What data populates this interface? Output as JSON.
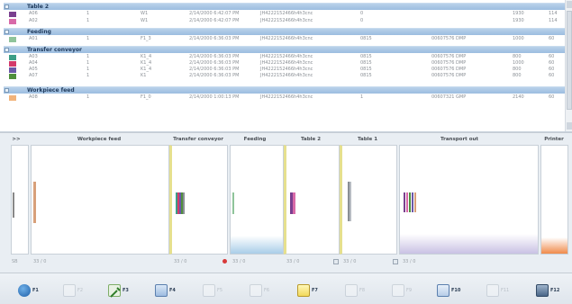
{
  "list": {
    "groups": [
      {
        "name": "Table 2",
        "rows": [
          {
            "color": "#7a3f8f",
            "id": "A06",
            "qty": "1",
            "pos": "W1",
            "time": "2/14/2000 6:42:07 PM",
            "code": "JH4222152466h4h3cnc",
            "n": "0",
            "order": "",
            "a": "1930",
            "b": "114"
          },
          {
            "color": "#d86aa8",
            "id": "A02",
            "qty": "1",
            "pos": "W1",
            "time": "2/14/2000 6:42:07 PM",
            "code": "JH4222152466h4h3cnc",
            "n": "0",
            "order": "",
            "a": "1930",
            "b": "114"
          }
        ]
      },
      {
        "name": "Feeding",
        "rows": [
          {
            "color": "#8fc49a",
            "id": "A01",
            "qty": "1",
            "pos": "F1_3",
            "time": "2/14/2000 6:36:03 PM",
            "code": "JH4222152466h4h3cnc",
            "n": "0815",
            "order": "00607576 DMP",
            "a": "1000",
            "b": "60"
          }
        ]
      },
      {
        "name": "Transfer conveyor",
        "rows": [
          {
            "color": "#3c9e86",
            "id": "A03",
            "qty": "1",
            "pos": "K1_4",
            "time": "2/14/2000 6:36:03 PM",
            "code": "JH4222152466h4h3cnc",
            "n": "0815",
            "order": "00607576 DMP",
            "a": "800",
            "b": "60"
          },
          {
            "color": "#d33a6a",
            "id": "A04",
            "qty": "1",
            "pos": "K1_4",
            "time": "2/14/2000 6:36:03 PM",
            "code": "JH4222152466h4h3cnc",
            "n": "0815",
            "order": "00607576 DMP",
            "a": "1000",
            "b": "60"
          },
          {
            "color": "#6a58a8",
            "id": "A05",
            "qty": "1",
            "pos": "K1_4",
            "time": "2/14/2000 6:36:03 PM",
            "code": "JH4222152466h4h3cnc",
            "n": "0815",
            "order": "00607576 DMP",
            "a": "800",
            "b": "60"
          },
          {
            "color": "#4f8f3c",
            "id": "A07",
            "qty": "1",
            "pos": "K1",
            "time": "2/14/2000 6:36:03 PM",
            "code": "JH4222152466h4h3cnc",
            "n": "0815",
            "order": "00607576 DMP",
            "a": "800",
            "b": "60"
          }
        ]
      },
      {
        "name": "Workpiece feed",
        "rows": [
          {
            "color": "#f2b37a",
            "id": "A08",
            "qty": "1",
            "pos": "F1_0",
            "time": "2/14/2000 1:00:13 PM",
            "code": "JH4222152466h4h3cnc",
            "n": "1",
            "order": "00607321 GMP",
            "a": "2140",
            "b": "60"
          }
        ]
      }
    ]
  },
  "panel": {
    "expand": ">>",
    "columns": [
      {
        "label": "Workpiece feed",
        "footer": "33 / 0"
      },
      {
        "label": "Transfer conveyor",
        "footer": "33 / 0"
      },
      {
        "label": "Feeding",
        "footer": "33 / 0"
      },
      {
        "label": "Table 2",
        "footer": "33 / 0"
      },
      {
        "label": "Table 1",
        "footer": "33 / 0"
      },
      {
        "label": "Transport out",
        "footer": "33 / 0"
      },
      {
        "label": "Printer",
        "footer": ""
      }
    ],
    "left_footer": "SB"
  },
  "toolbar": {
    "keys": [
      {
        "label": "F1",
        "icon": "help-icon"
      },
      {
        "label": "F2",
        "icon": "blank-icon"
      },
      {
        "label": "F3",
        "icon": "tools-icon"
      },
      {
        "label": "F4",
        "icon": "scanner-icon"
      },
      {
        "label": "F5",
        "icon": "blank-icon"
      },
      {
        "label": "F6",
        "icon": "blank-icon"
      },
      {
        "label": "F7",
        "icon": "notepad-icon"
      },
      {
        "label": "F8",
        "icon": "blank-icon"
      },
      {
        "label": "F9",
        "icon": "blank-icon"
      },
      {
        "label": "F10",
        "icon": "clipboard-icon"
      },
      {
        "label": "F11",
        "icon": "blank-icon"
      },
      {
        "label": "F12",
        "icon": "computer-icon"
      }
    ]
  }
}
